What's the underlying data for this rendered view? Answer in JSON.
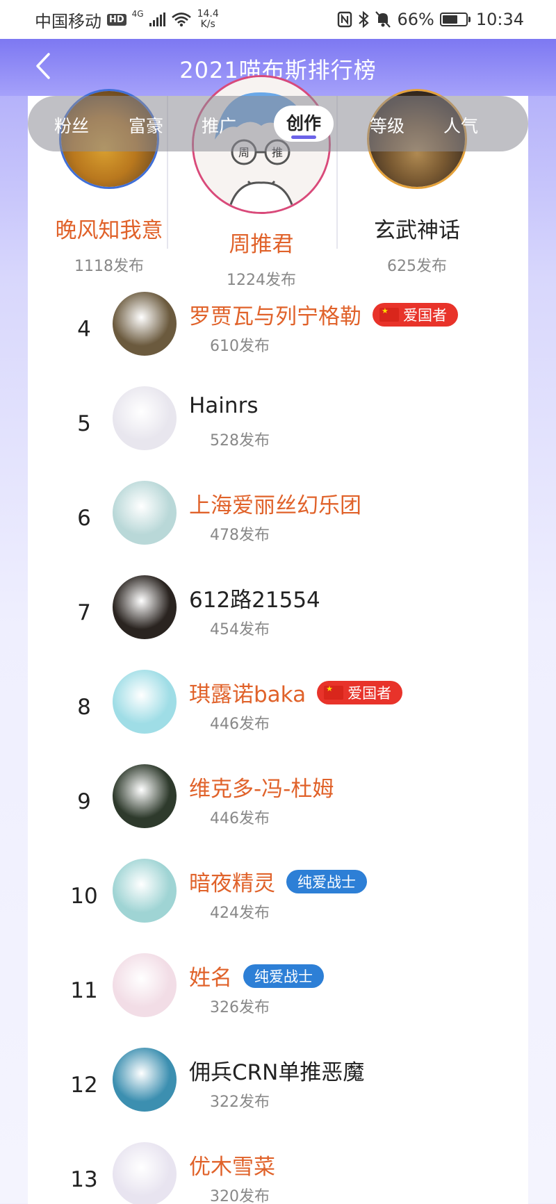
{
  "status_bar": {
    "carrier": "中国移动",
    "hd": "HD",
    "network": "4G",
    "speed_value": "14.4",
    "speed_unit": "K/s",
    "battery": "66%",
    "battery_level": 0.66,
    "time": "10:34"
  },
  "header": {
    "title": "2021喵布斯排行榜"
  },
  "tabs": [
    {
      "label": "粉丝",
      "active": false
    },
    {
      "label": "富豪",
      "active": false
    },
    {
      "label": "推广",
      "active": false
    },
    {
      "label": "创作",
      "active": true
    },
    {
      "label": "等级",
      "active": false
    },
    {
      "label": "人气",
      "active": false
    }
  ],
  "podium": [
    {
      "place": 2,
      "name": "晚风知我意",
      "count": "1118发布",
      "ring_color": "#3f6fd8",
      "name_color": "#e0622a"
    },
    {
      "place": 1,
      "name": "周推君",
      "count": "1224发布",
      "ring_color": "#d94a7a",
      "name_color": "#e0622a",
      "avatar_text": "周 推"
    },
    {
      "place": 3,
      "name": "玄武神话",
      "count": "625发布",
      "ring_color": "#e5a23a",
      "name_color": "#222222"
    }
  ],
  "list": [
    {
      "rank": "4",
      "name": "罗贾瓦与列宁格勒",
      "count": "610发布",
      "name_color": "orange",
      "badge": "爱国者",
      "badge_type": "red",
      "avatar_color": "#6b5a3e"
    },
    {
      "rank": "5",
      "name": "Hainrs",
      "count": "528发布",
      "name_color": "dark",
      "badge": "",
      "badge_type": "",
      "avatar_color": "#e8e6ee"
    },
    {
      "rank": "6",
      "name": "上海爱丽丝幻乐团",
      "count": "478发布",
      "name_color": "orange",
      "badge": "",
      "badge_type": "",
      "avatar_color": "#b9d8d8"
    },
    {
      "rank": "7",
      "name": "612路21554",
      "count": "454发布",
      "name_color": "dark",
      "badge": "",
      "badge_type": "",
      "avatar_color": "#2a2420"
    },
    {
      "rank": "8",
      "name": "琪露诺baka",
      "count": "446发布",
      "name_color": "orange",
      "badge": "爱国者",
      "badge_type": "red",
      "avatar_color": "#9fdde6"
    },
    {
      "rank": "9",
      "name": "维克多-冯-杜姆",
      "count": "446发布",
      "name_color": "orange",
      "badge": "",
      "badge_type": "",
      "avatar_color": "#2e3a2c"
    },
    {
      "rank": "10",
      "name": "暗夜精灵",
      "count": "424发布",
      "name_color": "orange",
      "badge": "纯爱战士",
      "badge_type": "blue",
      "avatar_color": "#9fd4d4"
    },
    {
      "rank": "11",
      "name": "姓名",
      "count": "326发布",
      "name_color": "orange",
      "badge": "纯爱战士",
      "badge_type": "blue",
      "avatar_color": "#f2dde6"
    },
    {
      "rank": "12",
      "name": "佣兵CRN单推恶魔",
      "count": "322发布",
      "name_color": "dark",
      "badge": "",
      "badge_type": "",
      "avatar_color": "#3c8fb0"
    },
    {
      "rank": "13",
      "name": "优木雪菜",
      "count": "320发布",
      "name_color": "orange",
      "badge": "",
      "badge_type": "",
      "avatar_color": "#e8e4f0"
    }
  ]
}
